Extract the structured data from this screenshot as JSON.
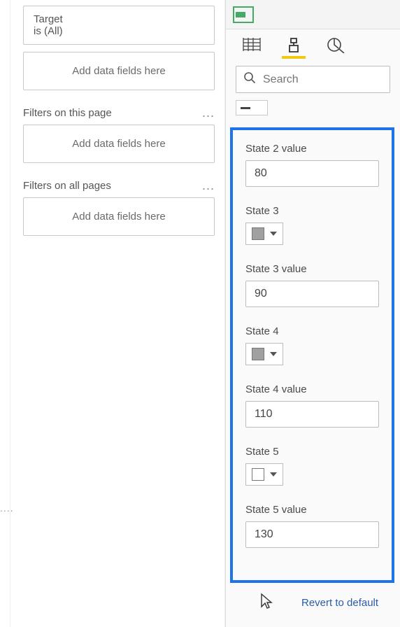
{
  "filters": {
    "target_field": "Target",
    "target_summary": "is (All)",
    "add_fields_placeholder": "Add data fields here",
    "page_filters_label": "Filters on this page",
    "all_pages_filters_label": "Filters on all pages"
  },
  "search": {
    "placeholder": "Search"
  },
  "format": {
    "state2_value_label": "State 2 value",
    "state2_value": "80",
    "state3_label": "State 3",
    "state3_color": "#a0a0a0",
    "state3_value_label": "State 3 value",
    "state3_value": "90",
    "state4_label": "State 4",
    "state4_color": "#a0a0a0",
    "state4_value_label": "State 4 value",
    "state4_value": "110",
    "state5_label": "State 5",
    "state5_color": "#ffffff",
    "state5_value_label": "State 5 value",
    "state5_value": "130"
  },
  "actions": {
    "revert_label": "Revert to default"
  }
}
